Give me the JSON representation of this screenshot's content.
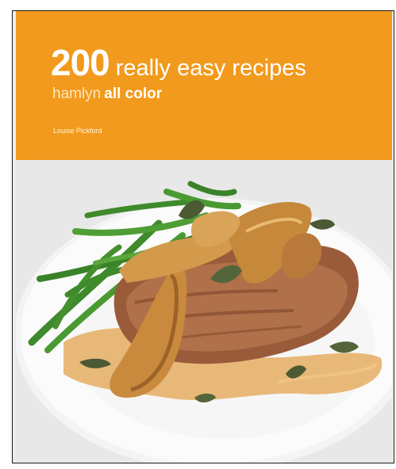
{
  "cover": {
    "title_number": "200",
    "title_text": "really easy recipes",
    "brand": "hamlyn",
    "series": "all color",
    "author": "Louise Pickford"
  },
  "colors": {
    "banner": "#f29a1d",
    "plate": "#fafafa",
    "background": "#ececec",
    "beans": "#3f8a2b",
    "pork": "#9a5b3a",
    "pear": "#c98a3e",
    "sauce": "#e0a55a"
  },
  "photo": {
    "subject": "plated-pork-chop-with-pears-and-green-beans"
  }
}
